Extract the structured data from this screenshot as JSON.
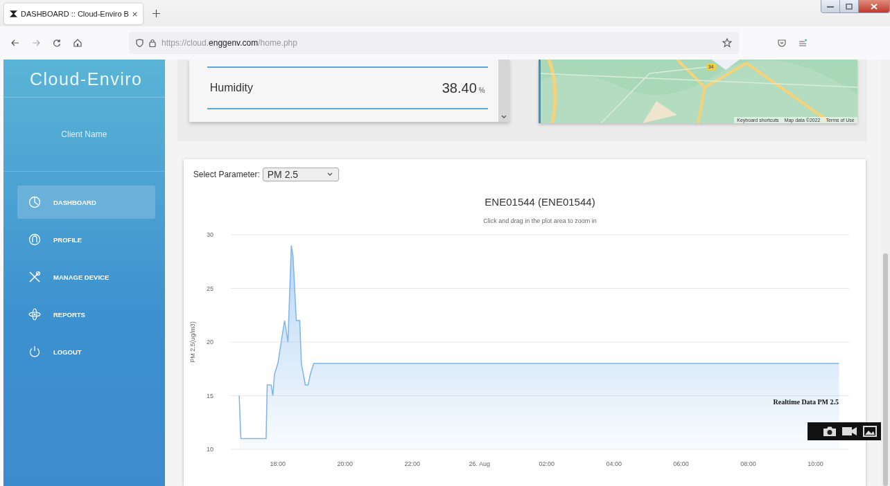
{
  "browser": {
    "tab_title": "DASHBOARD :: Cloud-Enviro B",
    "url": "https://cloud.**enggenv.com**/home.php"
  },
  "sidebar": {
    "brand": "Cloud-Enviro",
    "client_name": "Client Name",
    "items": [
      {
        "label": "DASHBOARD",
        "selected": true
      },
      {
        "label": "PROFILE",
        "selected": false
      },
      {
        "label": "MANAGE DEVICE",
        "selected": false
      },
      {
        "label": "REPORTS",
        "selected": false
      },
      {
        "label": "LOGOUT",
        "selected": false
      }
    ]
  },
  "humidity": {
    "label": "Humidity",
    "value": "38.40",
    "unit": "%"
  },
  "map": {
    "kind": "picture",
    "route_badge": "34",
    "attribution": [
      "Keyboard shortcuts",
      "Map data ©2022",
      "Terms of Use"
    ]
  },
  "chart_panel": {
    "select_label": "Select Parameter:",
    "select_value": "PM 2.5",
    "chart_data": {
      "type": "area",
      "title": "ENE01544 (ENE01544)",
      "subtitle": "Click and drag in the plot area to zoom in",
      "ylabel": "PM 2.5(ug/m3)",
      "x": [
        "2022-08-25T16:51",
        "2022-08-25T16:54",
        "2022-08-25T17:39",
        "2022-08-25T17:41",
        "2022-08-25T17:48",
        "2022-08-25T17:51",
        "2022-08-25T17:54",
        "2022-08-25T18:00",
        "2022-08-25T18:09",
        "2022-08-25T18:12",
        "2022-08-25T18:18",
        "2022-08-25T18:24",
        "2022-08-25T18:27",
        "2022-08-25T18:33",
        "2022-08-25T18:39",
        "2022-08-25T18:42",
        "2022-08-25T18:49",
        "2022-08-25T18:54",
        "2022-08-25T18:58",
        "2022-08-25T19:04",
        "2022-08-26T10:42"
      ],
      "series": [
        {
          "name": "Realtime Data PM 2.5",
          "color": "#7cb5ec",
          "values": [
            15,
            11,
            11,
            16,
            16,
            15,
            17,
            18,
            21,
            22,
            20,
            29,
            28,
            22,
            22,
            18,
            16,
            16,
            17,
            18,
            18
          ]
        }
      ],
      "xlim": [
        "2022-08-25T16:36",
        "2022-08-26T11:00"
      ],
      "ylim": [
        10,
        30
      ],
      "xticks": [
        {
          "value": "2022-08-25T18:00",
          "label": "18:00"
        },
        {
          "value": "2022-08-25T20:00",
          "label": "20:00"
        },
        {
          "value": "2022-08-25T22:00",
          "label": "22:00"
        },
        {
          "value": "2022-08-26T00:00",
          "label": "26. Aug"
        },
        {
          "value": "2022-08-26T02:00",
          "label": "02:00"
        },
        {
          "value": "2022-08-26T04:00",
          "label": "04:00"
        },
        {
          "value": "2022-08-26T06:00",
          "label": "06:00"
        },
        {
          "value": "2022-08-26T08:00",
          "label": "08:00"
        },
        {
          "value": "2022-08-26T10:00",
          "label": "10:00"
        }
      ],
      "yticks": [
        10,
        15,
        20,
        25,
        30
      ],
      "grid": true
    }
  }
}
